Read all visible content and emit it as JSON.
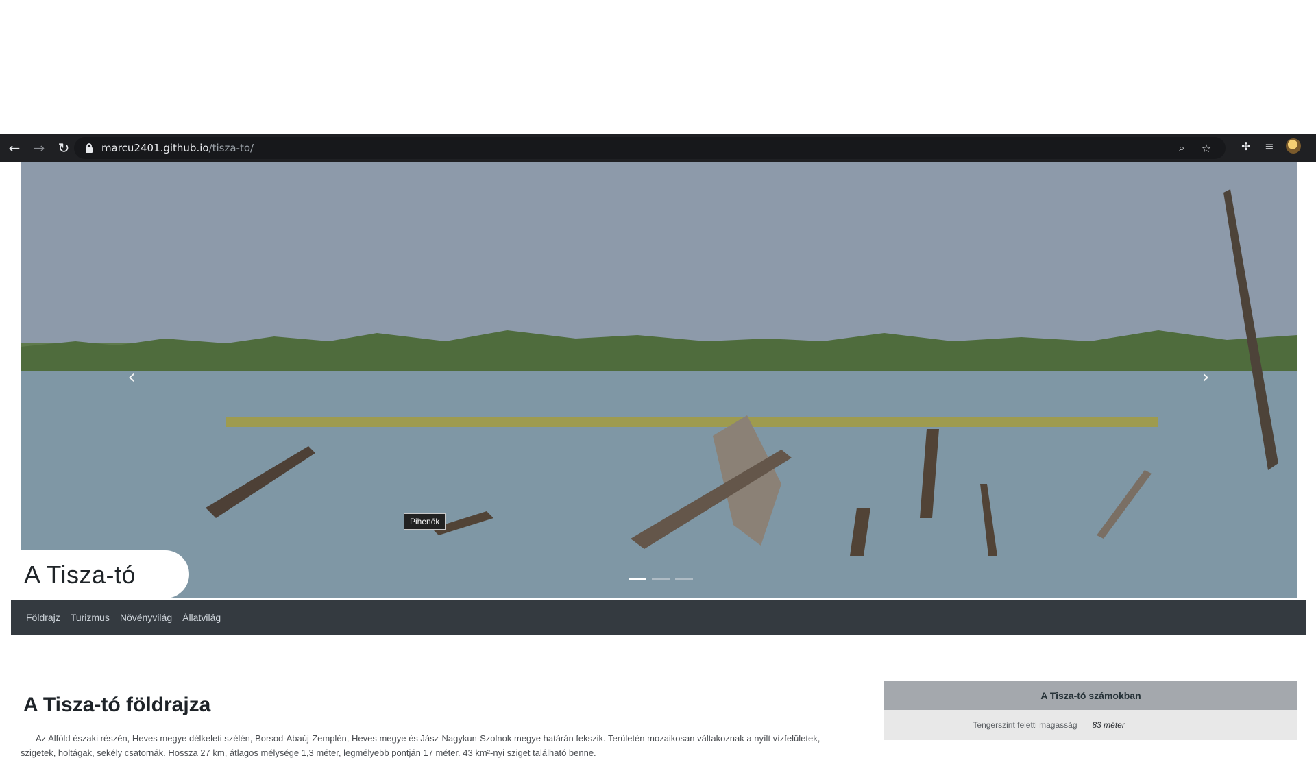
{
  "browser": {
    "url_host": "marcu2401.github.io",
    "url_path": "/tisza-to/"
  },
  "hero": {
    "site_title": "A Tisza-tó",
    "tooltip": "Pihenők",
    "slides": 3,
    "active_slide": 1
  },
  "nav": {
    "items": [
      "Földrajz",
      "Turizmus",
      "Növényvilág",
      "Állatvilág"
    ]
  },
  "main": {
    "section_title": "A Tisza-tó földrajza",
    "paragraph": "Az Alföld északi részén, Heves megye délkeleti szélén, Borsod-Abaúj-Zemplén, Heves megye és Jász-Nagykun-Szolnok megye határán fekszik. Területén mozaikosan váltakoznak a nyílt vízfelületek, szigetek, holtágak, sekély csatornák. Hossza 27 km, átlagos mélysége 1,3 méter, legmélyebb pontján 17 méter. 43 km²-nyi sziget található benne."
  },
  "facts": {
    "header": "A Tisza-tó számokban",
    "rows": [
      {
        "label": "Tengerszint feletti magasság",
        "value": "83 méter"
      }
    ]
  },
  "icons": {
    "back": "back-arrow-icon",
    "forward": "forward-arrow-icon",
    "reload": "reload-icon",
    "lock": "lock-icon",
    "zoom": "zoom-icon",
    "star": "bookmark-star-icon",
    "extensions": "extensions-icon",
    "reading": "reading-list-icon"
  }
}
